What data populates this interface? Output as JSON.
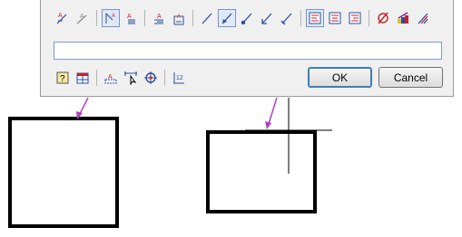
{
  "dialog": {
    "toolbar_icons": [
      "text-add-icon",
      "text-strike-icon",
      "leader-text-icon",
      "text-stack-icon",
      "text-list-icon",
      "text-align-icon",
      "line-icon",
      "arrow-closed-icon",
      "arrow-dot-icon",
      "arrow-open-icon",
      "arrow-oblique-icon",
      "align-left-icon",
      "align-center-icon",
      "align-right-icon",
      "diameter-icon",
      "color-icon",
      "style-icon"
    ],
    "text_value": "",
    "bottom_icons": [
      "help-icon",
      "table-icon",
      "text-frame-icon",
      "pick-icon",
      "target-icon",
      "number-icon"
    ],
    "ok_label": "OK",
    "cancel_label": "Cancel"
  },
  "colors": {
    "leader_arrow": "#b040c0",
    "icon_red": "#c8202a",
    "icon_blue": "#2a4f9a"
  }
}
